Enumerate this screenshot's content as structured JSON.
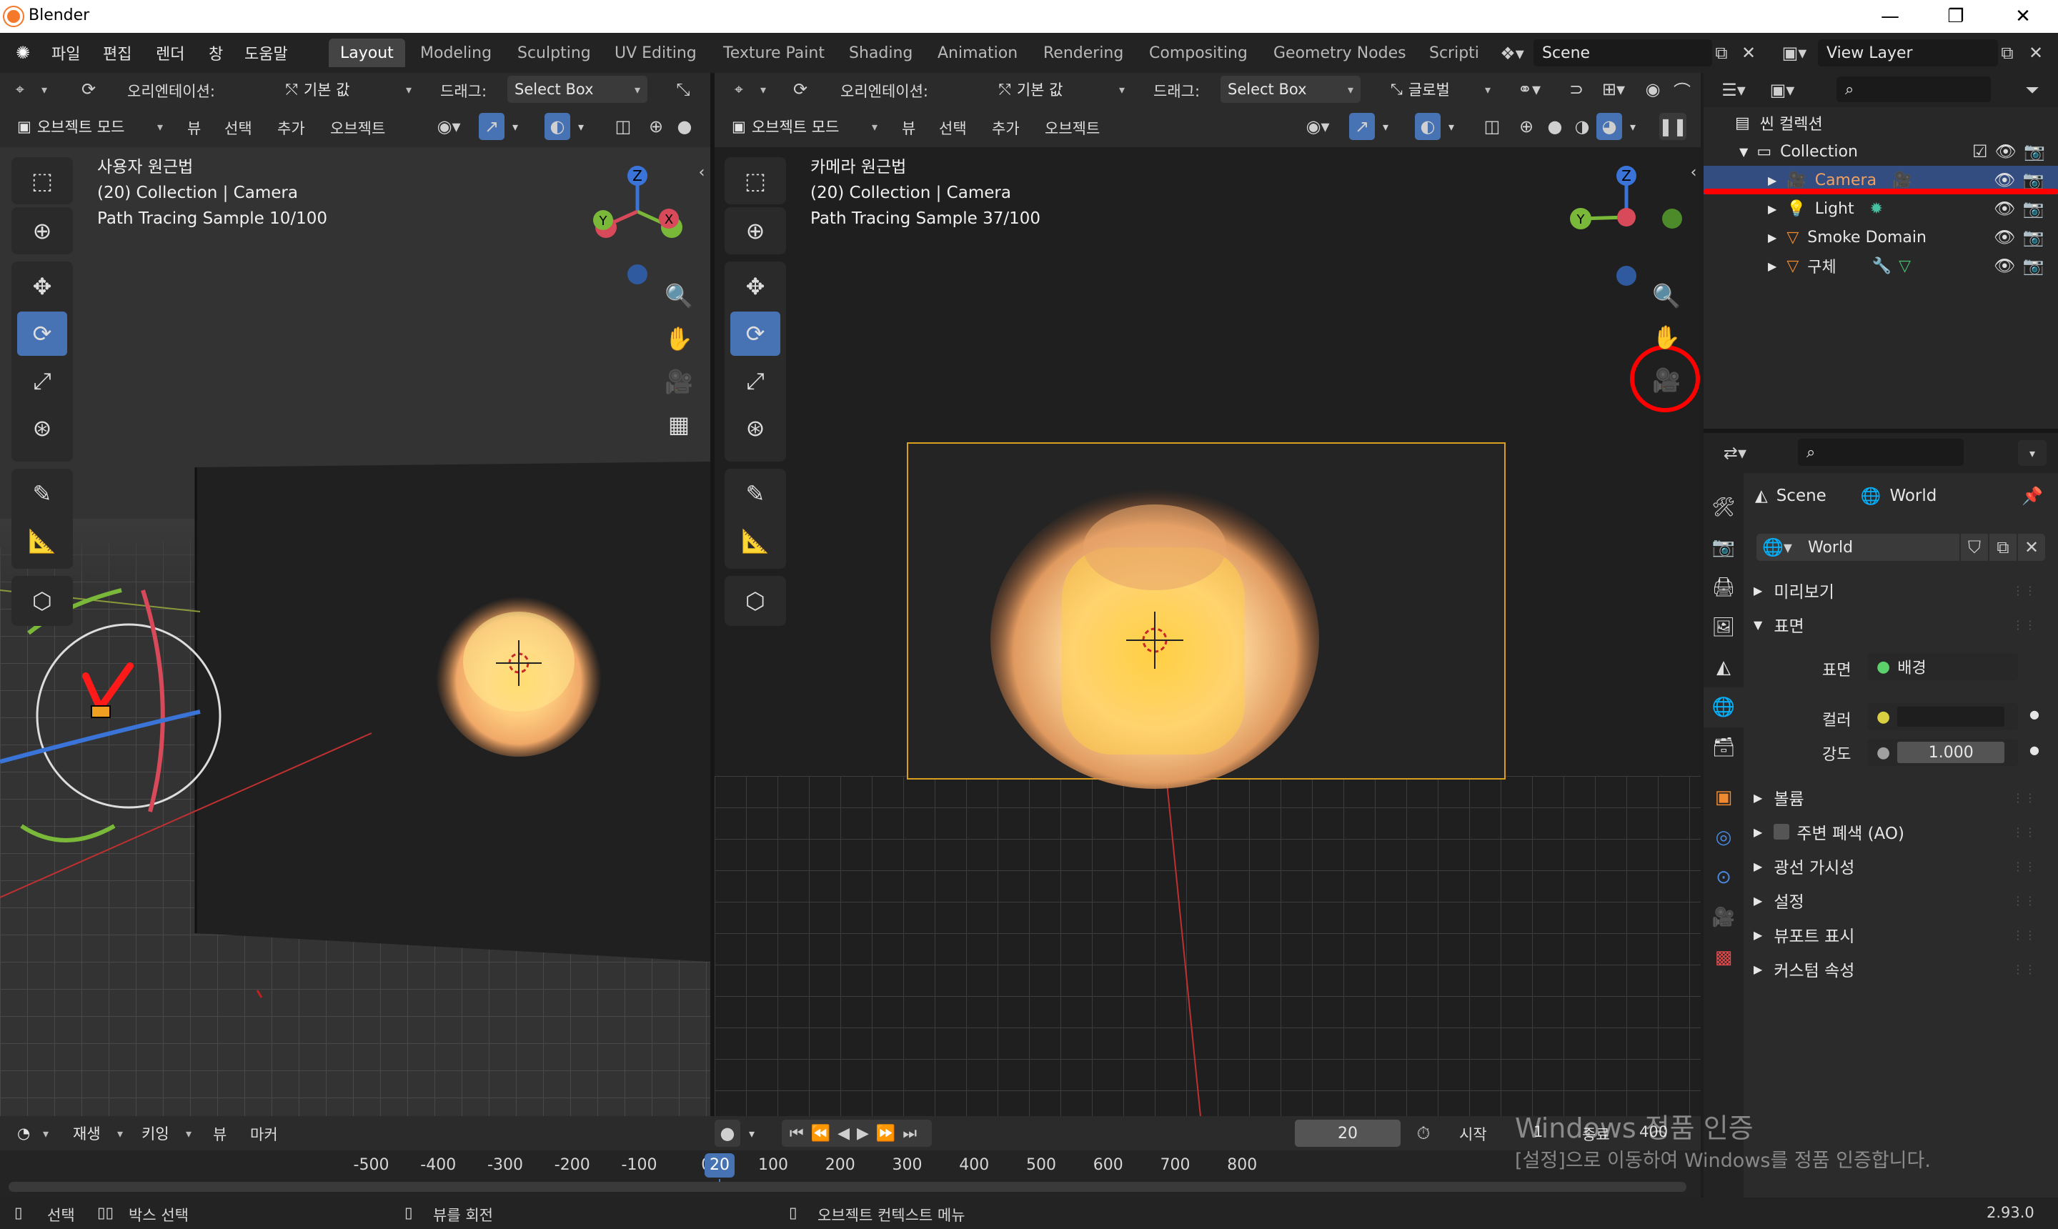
{
  "window": {
    "title": "Blender",
    "minimize": "—",
    "restore": "❐",
    "close": "✕"
  },
  "menu": [
    "파일",
    "편집",
    "렌더",
    "창",
    "도움말"
  ],
  "workspaces": [
    "Layout",
    "Modeling",
    "Sculpting",
    "UV Editing",
    "Texture Paint",
    "Shading",
    "Animation",
    "Rendering",
    "Compositing",
    "Geometry Nodes",
    "Scripti"
  ],
  "scene": {
    "name": "Scene",
    "view_layer": "View Layer"
  },
  "left_header": {
    "orientation_label": "오리엔테이션:",
    "orientation_value": "기본 값",
    "drag_label": "드래그:",
    "drag_value": "Select Box",
    "mode": "오브젝트 모드",
    "view": "뷰",
    "select": "선택",
    "add": "추가",
    "object": "오브젝트"
  },
  "right_header": {
    "orientation_label": "오리엔테이션:",
    "orientation_value": "기본 값",
    "drag_label": "드래그:",
    "drag_value": "Select Box",
    "transform": "글로벌",
    "mode": "오브젝트 모드",
    "view": "뷰",
    "select": "선택",
    "add": "추가",
    "object": "오브젝트"
  },
  "left_viewport": {
    "line1": "사용자 원근법",
    "line2": "(20) Collection | Camera",
    "line3": "Path Tracing Sample 10/100"
  },
  "right_viewport": {
    "line1": "카메라 원근법",
    "line2": "(20) Collection | Camera",
    "line3": "Path Tracing Sample 37/100"
  },
  "gizmo": {
    "z": "Z",
    "y": "Y",
    "x": "X"
  },
  "outliner": {
    "scene_collection": "씬 컬렉션",
    "items": [
      {
        "name": "Collection"
      },
      {
        "name": "Camera"
      },
      {
        "name": "Light"
      },
      {
        "name": "Smoke Domain"
      },
      {
        "name": "구체"
      }
    ]
  },
  "properties": {
    "breadcrumb_scene": "Scene",
    "breadcrumb_world": "World",
    "world_name": "World",
    "panels": {
      "preview": "미리보기",
      "surface": "표면",
      "volume": "볼륨",
      "ao": "주변 폐색 (AO)",
      "ray_visibility": "광선 가시성",
      "settings": "설정",
      "viewport_display": "뷰포트 표시",
      "custom_props": "커스텀 속성"
    },
    "surface_label": "표면",
    "surface_value": "배경",
    "color_label": "컬러",
    "strength_label": "강도",
    "strength_value": "1.000"
  },
  "timeline": {
    "playback": "재생",
    "keying": "키잉",
    "view": "뷰",
    "marker": "마커",
    "current_frame": "20",
    "start_label": "시작",
    "start_value": "1",
    "end_label": "종료",
    "end_value": "400",
    "ruler": [
      "-500",
      "-400",
      "-300",
      "-200",
      "-100",
      "0",
      "20",
      "100",
      "200",
      "300",
      "400",
      "500",
      "600",
      "700",
      "800"
    ]
  },
  "watermark": {
    "line1": "Windows 정품 인증",
    "line2": "[설정]으로 이동하여 Windows를 정품 인증합니다."
  },
  "status": {
    "select": "선택",
    "box_select": "박스 선택",
    "rotate_view": "뷰를 회전",
    "context_menu": "오브젝트 컨텍스트 메뉴",
    "version": "2.93.0"
  },
  "colors": {
    "accent": "#4772b3",
    "annotation": "#ff0000",
    "fire": "#ffb347"
  }
}
